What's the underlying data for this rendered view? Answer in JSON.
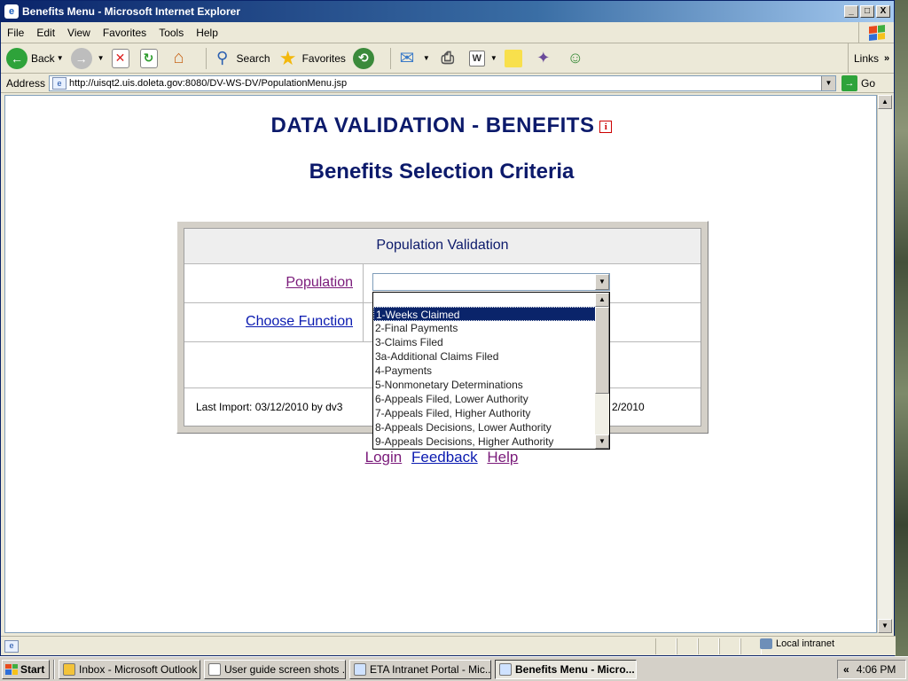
{
  "window": {
    "title": "Benefits Menu - Microsoft Internet Explorer",
    "controls": [
      "_",
      "□",
      "X"
    ]
  },
  "menu": [
    "File",
    "Edit",
    "View",
    "Favorites",
    "Tools",
    "Help"
  ],
  "toolbar": {
    "back_label": "Back",
    "search_label": "Search",
    "favorites_label": "Favorites",
    "links_label": "Links"
  },
  "address": {
    "label": "Address",
    "url": "http://uisqt2.uis.doleta.gov:8080/DV-WS-DV/PopulationMenu.jsp",
    "go_label": "Go"
  },
  "page": {
    "title": "DATA VALIDATION - BENEFITS",
    "info_glyph": "i",
    "subtitle": "Benefits Selection Criteria",
    "panel_header": "Population Validation",
    "population_label": "Population",
    "choose_function_label": "Choose Function",
    "last_import": "Last Import: 03/12/2010 by dv3",
    "last_date_fragment": "2/2010",
    "selected_population": "",
    "population_options": [
      "",
      "1-Weeks Claimed",
      "2-Final Payments",
      "3-Claims Filed",
      "3a-Additional Claims Filed",
      "4-Payments",
      "5-Nonmonetary Determinations",
      "6-Appeals Filed, Lower Authority",
      "7-Appeals Filed, Higher Authority",
      "8-Appeals Decisions, Lower Authority",
      "9-Appeals Decisions, Higher Authority"
    ],
    "highlighted_option": "1-Weeks Claimed",
    "footer_links": [
      "Login",
      "Feedback",
      "Help"
    ]
  },
  "status": {
    "zone": "Local intranet"
  },
  "taskbar": {
    "start_label": "Start",
    "tasks": [
      "Inbox - Microsoft Outlook",
      "User guide screen shots ...",
      "ETA Intranet Portal - Mic...",
      "Benefits Menu - Micro..."
    ],
    "tray_chevron": "«",
    "clock": "4:06 PM"
  }
}
